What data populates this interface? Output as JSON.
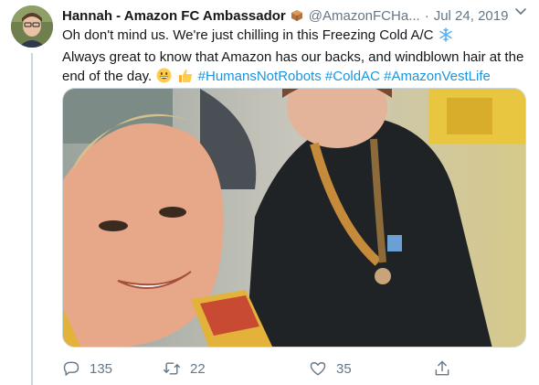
{
  "author": {
    "name": "Hannah - Amazon FC Ambassador",
    "handle": "@AmazonFCHa...",
    "separator": "·",
    "date": "Jul 24, 2019",
    "badge_icon": "package-icon"
  },
  "tweet": {
    "line1_text": "Oh don't mind us. We're just chilling in this Freezing Cold A/C",
    "line1_emoji": "snowflake-icon",
    "line2_text": "Always great to know that Amazon has our backs, and windblown hair at the",
    "line3_text": "end of the day.",
    "line3_emojis": [
      "grinning-face-icon",
      "thumbs-up-icon"
    ],
    "hashtags": [
      "#HumansNotRobots",
      "#ColdAC",
      "#AmazonVestLife"
    ]
  },
  "media": {
    "description_icon": "selfie-photo"
  },
  "actions": {
    "replies": "135",
    "retweets": "22",
    "likes": "35"
  },
  "colors": {
    "text": "#14171a",
    "secondary": "#657786",
    "link": "#1b95e0",
    "border": "#ccd6dd"
  }
}
